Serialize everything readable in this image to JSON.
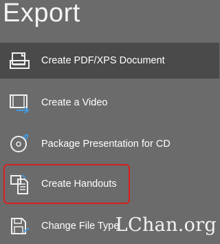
{
  "page": {
    "title": "Export"
  },
  "menu": {
    "items": [
      {
        "label": "Create PDF/XPS Document",
        "icon": "pdf-xps-icon",
        "selected": true
      },
      {
        "label": "Create a Video",
        "icon": "video-icon",
        "selected": false
      },
      {
        "label": "Package Presentation for CD",
        "icon": "cd-icon",
        "selected": false
      },
      {
        "label": "Create Handouts",
        "icon": "handouts-icon",
        "selected": false
      },
      {
        "label": "Change File Type",
        "icon": "change-file-type-icon",
        "selected": false
      }
    ]
  },
  "watermark": {
    "text": "LChan.org"
  },
  "colors": {
    "background": "#6b6b6b",
    "selected_background": "#4a4a4a",
    "highlight": "#d6201f",
    "accent_icon": "#3f9be8"
  }
}
